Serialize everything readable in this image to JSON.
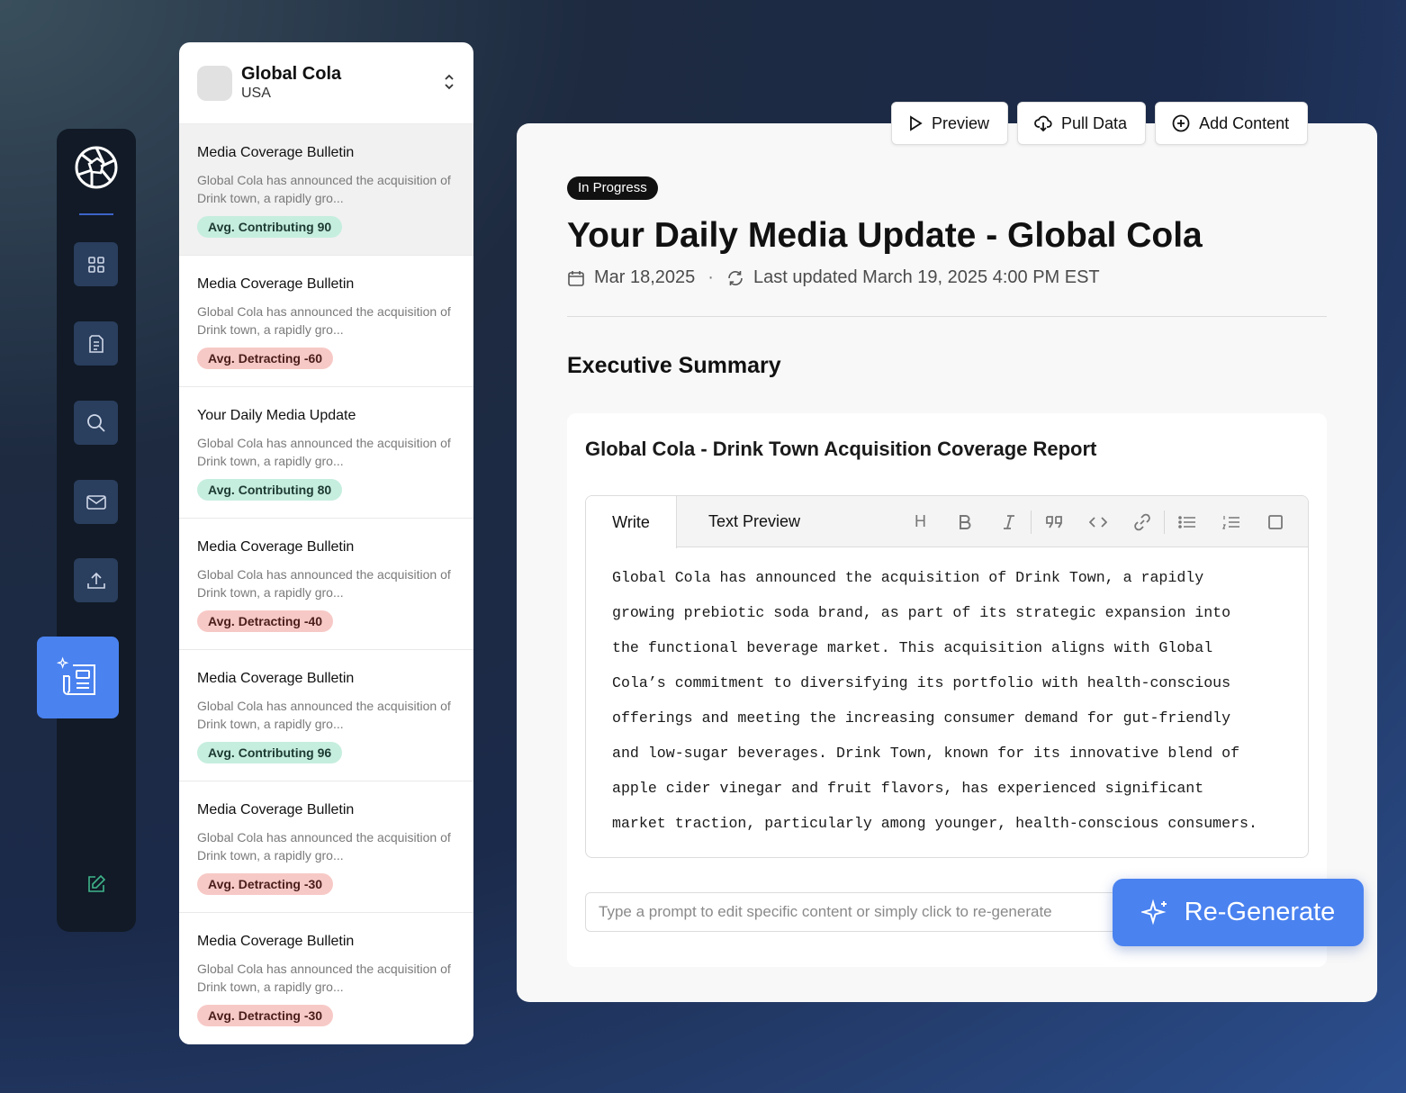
{
  "brand": {
    "name": "Global Cola",
    "country": "USA"
  },
  "list_items": [
    {
      "title": "Media Coverage Bulletin",
      "description": "Global Cola has announced the acquisition of Drink town, a rapidly gro...",
      "badge": "Avg. Contributing 90",
      "sentiment": "positive"
    },
    {
      "title": "Media Coverage Bulletin",
      "description": "Global Cola has announced the acquisition of Drink town, a rapidly gro...",
      "badge": "Avg. Detracting -60",
      "sentiment": "negative"
    },
    {
      "title": "Your Daily Media Update",
      "description": "Global Cola has announced the acquisition of Drink town, a rapidly gro...",
      "badge": "Avg. Contributing 80",
      "sentiment": "positive"
    },
    {
      "title": "Media Coverage Bulletin",
      "description": "Global Cola has announced the acquisition of Drink town, a rapidly gro...",
      "badge": "Avg. Detracting -40",
      "sentiment": "negative"
    },
    {
      "title": "Media Coverage Bulletin",
      "description": "Global Cola has announced the acquisition of Drink town, a rapidly gro...",
      "badge": "Avg. Contributing 96",
      "sentiment": "positive"
    },
    {
      "title": "Media Coverage Bulletin",
      "description": "Global Cola has announced the acquisition of Drink town, a rapidly gro...",
      "badge": "Avg. Detracting -30",
      "sentiment": "negative"
    },
    {
      "title": "Media Coverage Bulletin",
      "description": "Global Cola has announced the acquisition of Drink town, a rapidly gro...",
      "badge": "Avg. Detracting -30",
      "sentiment": "negative"
    }
  ],
  "actions": {
    "preview": "Preview",
    "pull_data": "Pull Data",
    "add_content": "Add Content"
  },
  "main": {
    "status": "In Progress",
    "title": "Your Daily Media Update - Global Cola",
    "date": "Mar 18,2025",
    "separator": "·",
    "last_updated": "Last updated March 19, 2025 4:00 PM EST",
    "section_title": "Executive Summary",
    "card_title": "Global Cola - Drink Town Acquisition Coverage Report"
  },
  "editor": {
    "tab_write": "Write",
    "tab_preview": "Text Preview",
    "heading_tool": "H",
    "body_lines": [
      "Global Cola has announced the acquisition of Drink Town, a rapidly",
      "growing prebiotic soda brand, as part of its strategic expansion into",
      "the functional beverage market. This acquisition aligns with Global",
      "Cola’s commitment to diversifying its portfolio with health-conscious",
      "offerings and meeting the increasing consumer demand for gut-friendly",
      "and low-sugar beverages. Drink Town, known for its innovative blend of",
      "apple cider vinegar and fruit flavors, has experienced significant",
      "market traction, particularly among younger, health-conscious consumers."
    ]
  },
  "prompt": {
    "placeholder": "Type a prompt to edit specific content or simply click to re-generate",
    "value": ""
  },
  "regenerate_label": "Re-Generate",
  "colors": {
    "accent": "#4a82f0",
    "positive_badge": "#c6eedf",
    "negative_badge": "#f7c9c6",
    "rail_bg": "#111a26",
    "rail_button": "#2a3e5e"
  },
  "icons": {
    "rail": [
      "aperture-logo-icon",
      "grid-icon",
      "document-icon",
      "search-icon",
      "mail-icon",
      "upload-icon",
      "newsletter-sparkle-icon",
      "edit-icon"
    ],
    "toolbar": [
      "heading-icon",
      "bold-icon",
      "italic-icon",
      "quote-icon",
      "code-icon",
      "link-icon",
      "bullet-list-icon",
      "numbered-list-icon",
      "checkbox-icon"
    ]
  }
}
